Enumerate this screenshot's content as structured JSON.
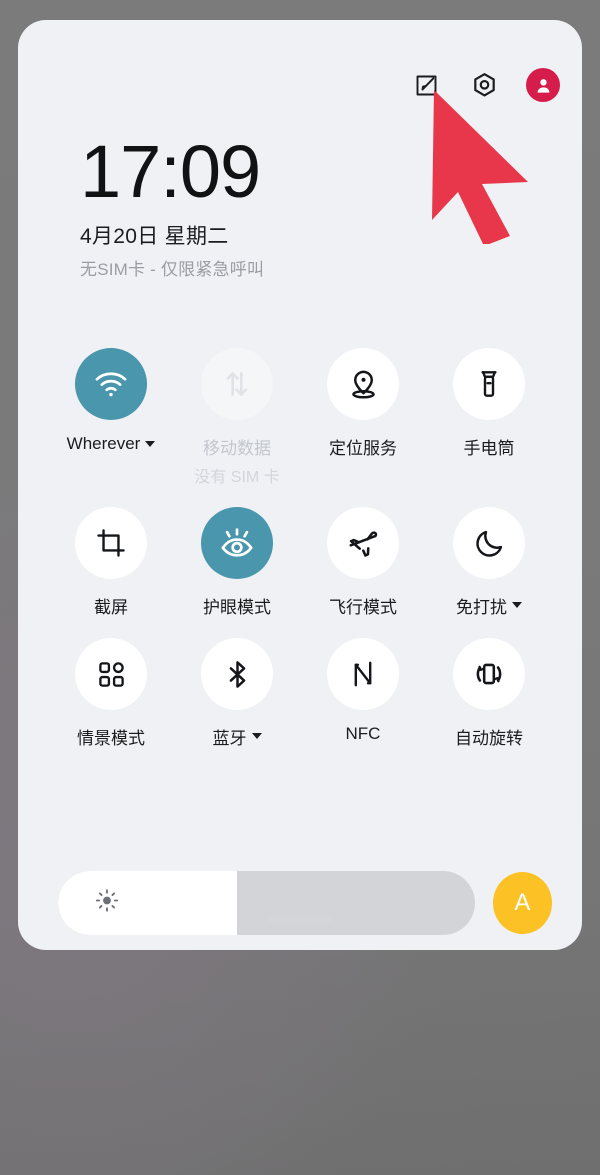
{
  "theme": {
    "panel_bg": "#eff1f4",
    "active_accent": "#4a96ad",
    "avatar_accent": "#d61c4a",
    "auto_brightness_accent": "#fcc225",
    "backdrop": "#7b7b7b",
    "cursor_color": "#e8374a"
  },
  "header": {
    "edit_icon": "edit-square-icon",
    "settings_icon": "hex-gear-icon",
    "account_icon": "user-avatar-icon"
  },
  "status": {
    "time": "17:09",
    "date": "4月20日  星期二",
    "carrier": "无SIM卡 - 仅限紧急呼叫"
  },
  "toggles": [
    [
      {
        "id": "wifi",
        "icon": "wifi-icon",
        "label": "Wherever",
        "state": "on",
        "has_dropdown": true,
        "sub": ""
      },
      {
        "id": "mobile-data",
        "icon": "data-transfer-icon",
        "label": "移动数据",
        "state": "disabled",
        "has_dropdown": false,
        "sub": "没有 SIM 卡"
      },
      {
        "id": "location",
        "icon": "location-pin-icon",
        "label": "定位服务",
        "state": "off",
        "has_dropdown": false,
        "sub": ""
      },
      {
        "id": "flashlight",
        "icon": "flashlight-icon",
        "label": "手电筒",
        "state": "off",
        "has_dropdown": false,
        "sub": ""
      }
    ],
    [
      {
        "id": "screenshot",
        "icon": "crop-icon",
        "label": "截屏",
        "state": "off",
        "has_dropdown": false,
        "sub": ""
      },
      {
        "id": "eye-comfort",
        "icon": "eye-icon",
        "label": "护眼模式",
        "state": "on",
        "has_dropdown": false,
        "sub": ""
      },
      {
        "id": "airplane",
        "icon": "airplane-icon",
        "label": "飞行模式",
        "state": "off",
        "has_dropdown": false,
        "sub": ""
      },
      {
        "id": "dnd",
        "icon": "moon-icon",
        "label": "免打扰",
        "state": "off",
        "has_dropdown": true,
        "sub": ""
      }
    ],
    [
      {
        "id": "scene-mode",
        "icon": "grid-apps-icon",
        "label": "情景模式",
        "state": "off",
        "has_dropdown": false,
        "sub": ""
      },
      {
        "id": "bluetooth",
        "icon": "bluetooth-icon",
        "label": "蓝牙",
        "state": "off",
        "has_dropdown": true,
        "sub": ""
      },
      {
        "id": "nfc",
        "icon": "nfc-icon",
        "label": "NFC",
        "state": "off",
        "has_dropdown": false,
        "sub": ""
      },
      {
        "id": "auto-rotate",
        "icon": "auto-rotate-icon",
        "label": "自动旋转",
        "state": "off",
        "has_dropdown": false,
        "sub": ""
      }
    ]
  ],
  "brightness": {
    "icon": "sun-icon",
    "value_percent": 43,
    "auto_label": "A"
  }
}
